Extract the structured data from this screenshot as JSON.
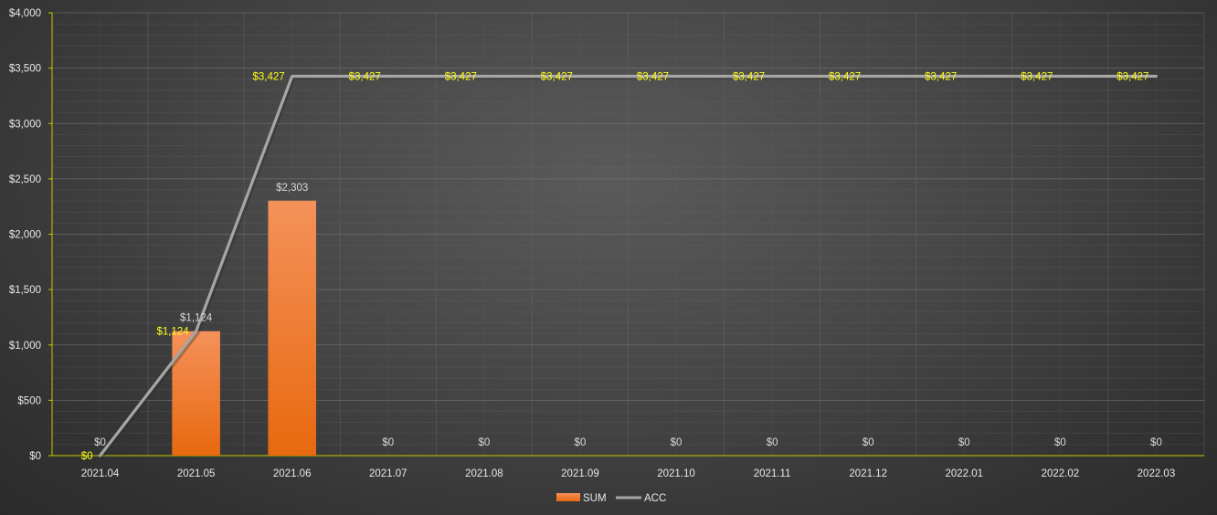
{
  "chart_data": {
    "type": "bar",
    "categories": [
      "2021.04",
      "2021.05",
      "2021.06",
      "2021.07",
      "2021.08",
      "2021.09",
      "2021.10",
      "2021.11",
      "2021.12",
      "2022.01",
      "2022.02",
      "2022.03"
    ],
    "series": [
      {
        "name": "SUM",
        "type": "bar",
        "values": [
          0,
          1124,
          2303,
          0,
          0,
          0,
          0,
          0,
          0,
          0,
          0,
          0
        ],
        "labels": [
          "$0",
          "$1,124",
          "$2,303",
          "$0",
          "$0",
          "$0",
          "$0",
          "$0",
          "$0",
          "$0",
          "$0",
          "$0"
        ],
        "color": "#f07f2a"
      },
      {
        "name": "ACC",
        "type": "line",
        "values": [
          0,
          1124,
          3427,
          3427,
          3427,
          3427,
          3427,
          3427,
          3427,
          3427,
          3427,
          3427
        ],
        "labels": [
          "$0",
          "$1,124",
          "$3,427",
          "$3,427",
          "$3,427",
          "$3,427",
          "$3,427",
          "$3,427",
          "$3,427",
          "$3,427",
          "$3,427",
          "$3,427"
        ],
        "color": "#a6a6a6"
      }
    ],
    "ylim": [
      0,
      4000
    ],
    "yticks": [
      0,
      500,
      1000,
      1500,
      2000,
      2500,
      3000,
      3500,
      4000
    ],
    "ytick_labels": [
      "$0",
      "$500",
      "$1,000",
      "$1,500",
      "$2,000",
      "$2,500",
      "$3,000",
      "$3,500",
      "$4,000"
    ],
    "title": "",
    "xlabel": "",
    "ylabel": "",
    "grid": true,
    "legend_position": "bottom",
    "axis_color": "#c8c800",
    "line_label_color": "#ffff1a"
  }
}
